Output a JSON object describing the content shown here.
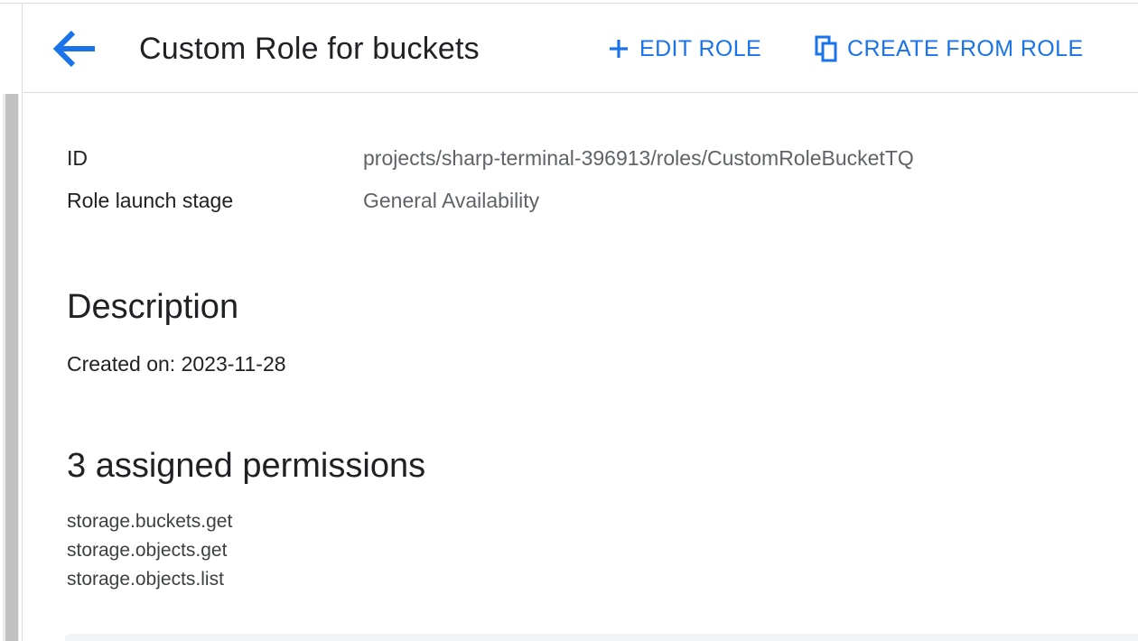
{
  "header": {
    "title": "Custom Role for buckets",
    "back_icon": "arrow-back-icon",
    "actions": [
      {
        "label": "EDIT ROLE",
        "icon": "plus-icon"
      },
      {
        "label": "CREATE FROM ROLE",
        "icon": "copy-icon"
      }
    ]
  },
  "details": {
    "id_label": "ID",
    "id_value": "projects/sharp-terminal-396913/roles/CustomRoleBucketTQ",
    "stage_label": "Role launch stage",
    "stage_value": "General Availability"
  },
  "description": {
    "title": "Description",
    "text": "Created on: 2023-11-28"
  },
  "permissions": {
    "title": "3 assigned permissions",
    "items": [
      "storage.buckets.get",
      "storage.objects.get",
      "storage.objects.list"
    ]
  },
  "colors": {
    "accent": "#1a73e8",
    "text_primary": "#202124",
    "text_secondary": "#5f6368"
  }
}
